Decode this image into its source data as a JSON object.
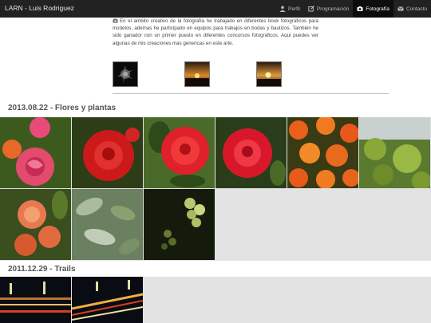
{
  "navbar": {
    "brand": "LARN - Luis Rodriguez",
    "items": [
      {
        "label": "Perfil",
        "icon": "user-icon"
      },
      {
        "label": "Programación",
        "icon": "edit-icon"
      },
      {
        "label": "Fotografía",
        "icon": "camera-icon",
        "active": true
      },
      {
        "label": "Contacto",
        "icon": "envelope-icon"
      }
    ]
  },
  "intro": {
    "icon": "camera-icon",
    "text": "En el ambito creativo de la fotografía he trabajado en diferentes book fotográficos para modelos, ademas he participado en equipos para trabajos en bodas y bautizos. También he sido ganador con un primer puesto en diferentes concursos fotográficos. Aqui puedes ver algunas de mis creaciones mas genericas en este arte."
  },
  "thumbnails": [
    "dark-flower-photo",
    "sunset-photo",
    "sunset-photo"
  ],
  "galleries": [
    {
      "title": "2013.08.22 - Flores y plantas",
      "photos": [
        "pink-rose",
        "red-rose",
        "red-rose",
        "red-rose",
        "orange-marigolds",
        "green-buds",
        "peaches",
        "leaves",
        "grapes"
      ]
    },
    {
      "title": "2011.12.29 - Trails",
      "photos": [
        "night-traffic",
        "night-traffic"
      ]
    }
  ],
  "colors": {
    "navbar": "#222222",
    "active_nav": "#0d0d0d",
    "band": "#e3e3e3"
  }
}
